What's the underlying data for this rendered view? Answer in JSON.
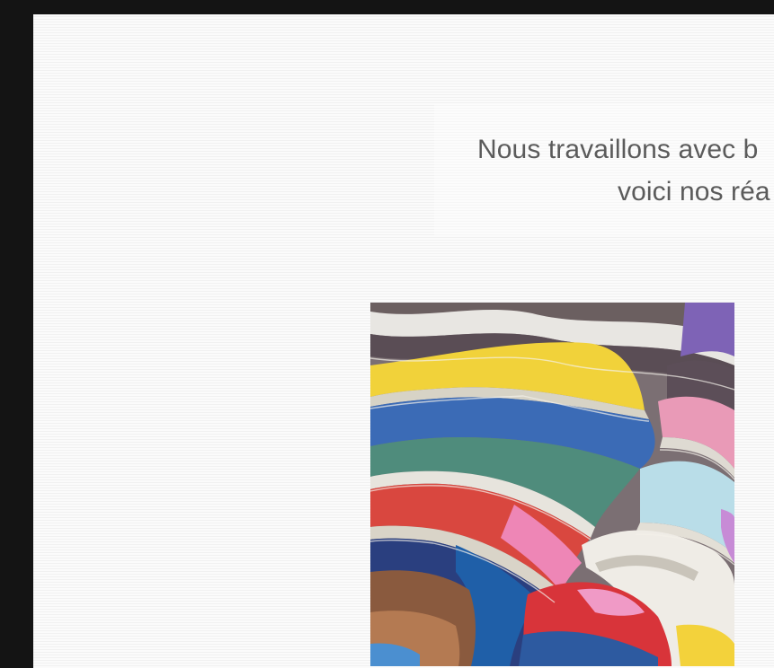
{
  "intro": {
    "line1": "Nous travaillons avec b",
    "line2": "voici nos réa"
  },
  "image": {
    "subject": "stack-of-open-magazines"
  }
}
